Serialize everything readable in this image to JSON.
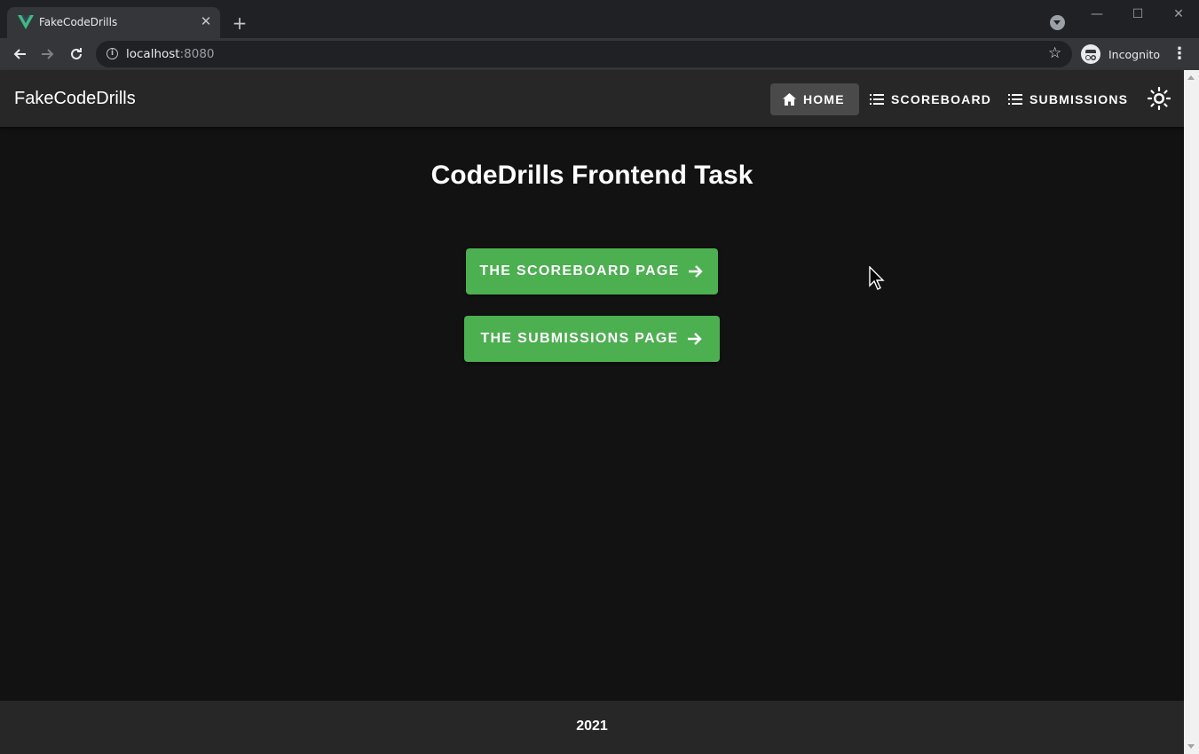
{
  "browser": {
    "tab_title": "FakeCodeDrills",
    "tab_close": "✕",
    "new_tab": "+",
    "url_host": "localhost",
    "url_port": ":8080",
    "profile_label": "Incognito",
    "window_minimize": "—",
    "window_maximize": "☐",
    "window_close": "✕",
    "colors": {
      "tab_bar": "#202124",
      "toolbar": "#35363a",
      "favicon_green": "#41b883",
      "favicon_dark": "#34495e"
    }
  },
  "app": {
    "brand": "FakeCodeDrills",
    "nav": [
      {
        "label": "HOME",
        "icon": "home-icon",
        "active": true
      },
      {
        "label": "SCOREBOARD",
        "icon": "list-icon",
        "active": false
      },
      {
        "label": "SUBMISSIONS",
        "icon": "list-icon",
        "active": false
      }
    ],
    "theme_toggle_icon": "sun-icon",
    "title": "CodeDrills Frontend Task",
    "buttons": [
      {
        "label": "THE SCOREBOARD PAGE",
        "icon": "arrow-right-icon"
      },
      {
        "label": "THE SUBMISSIONS PAGE",
        "icon": "arrow-right-icon"
      }
    ],
    "footer_year": "2021",
    "colors": {
      "background": "#121212",
      "app_bar": "#272727",
      "accent_green": "#4caf50",
      "active_nav": "#4a4a4a",
      "text": "#ffffff"
    }
  }
}
